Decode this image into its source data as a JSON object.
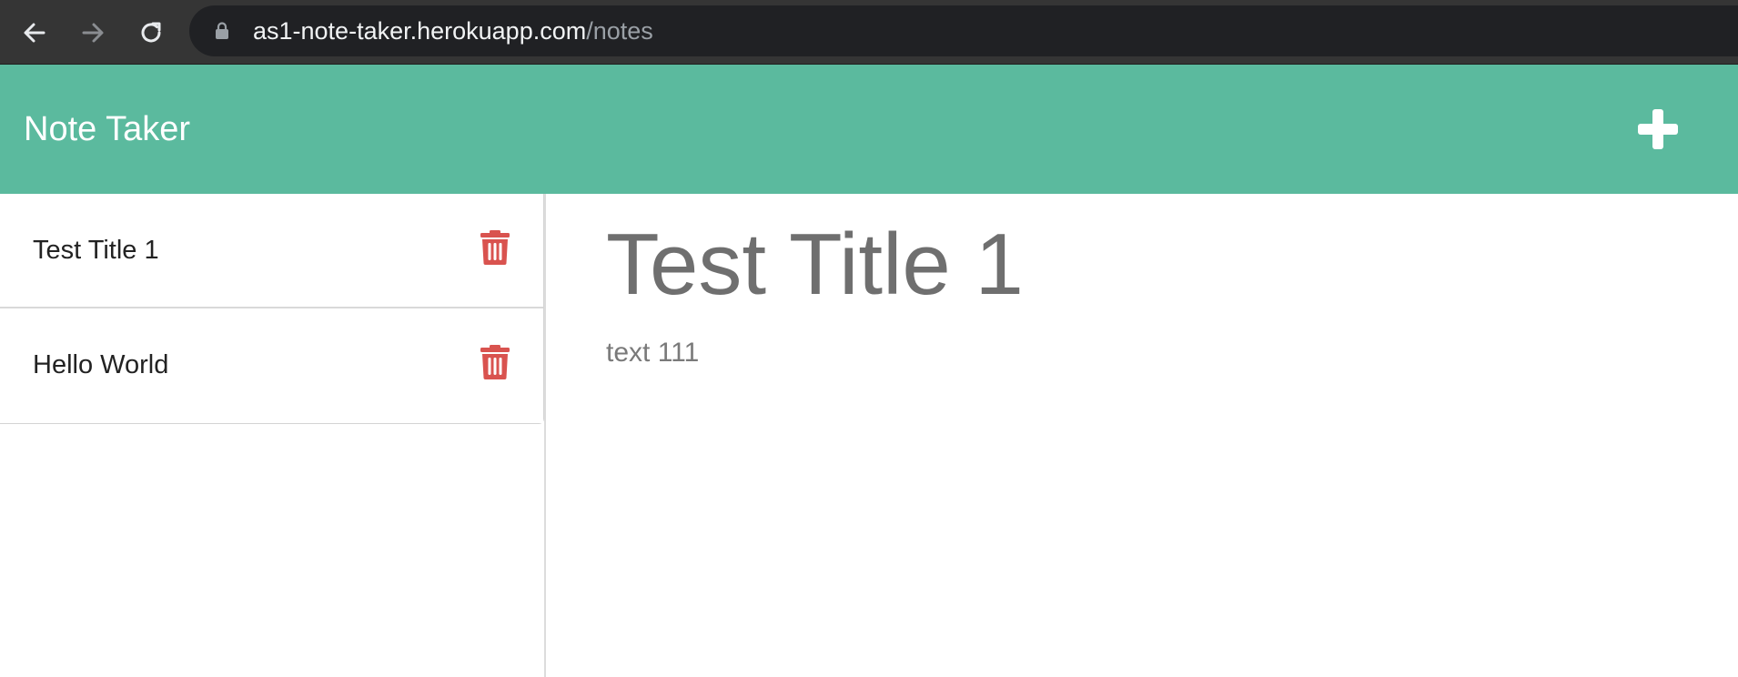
{
  "browser": {
    "url_host": "as1-note-taker.herokuapp.com",
    "url_path": "/notes",
    "icons": {
      "back": "arrow-left-icon",
      "forward": "arrow-right-icon",
      "reload": "reload-icon",
      "lock": "lock-icon"
    }
  },
  "header": {
    "title": "Note Taker",
    "add_icon": "plus-icon",
    "background_color": "#5bba9e"
  },
  "notes_list": {
    "items": [
      {
        "title": "Test Title 1",
        "delete_icon": "trash-icon"
      },
      {
        "title": "Hello World",
        "delete_icon": "trash-icon"
      }
    ],
    "delete_icon_color": "#d9534f"
  },
  "active_note": {
    "title": "Test Title 1",
    "text": "text 111"
  }
}
